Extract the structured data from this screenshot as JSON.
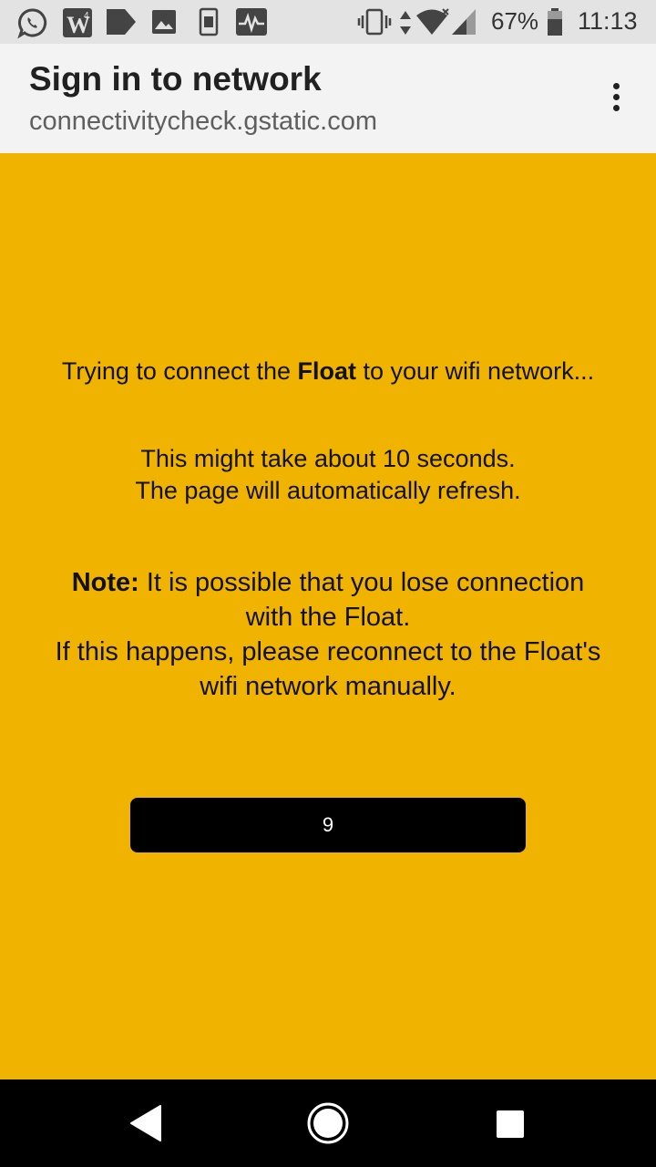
{
  "status_bar": {
    "icons": [
      "whatsapp-icon",
      "w-notification-icon",
      "play-icon",
      "image-icon",
      "sim-icon",
      "activity-icon",
      "vibrate-icon",
      "data-arrows-icon",
      "wifi-icon",
      "signal-icon",
      "battery-icon"
    ],
    "battery_percent": "67%",
    "time": "11:13"
  },
  "app_bar": {
    "title": "Sign in to network",
    "url": "connectivitycheck.gstatic.com",
    "menu_icon": "overflow-menu-icon"
  },
  "content": {
    "background": "#f0b400",
    "message1_before": "Trying to connect the ",
    "message1_bold": "Float",
    "message1_after": " to your wifi network...",
    "message2_line1": "This might take about 10 seconds.",
    "message2_line2": "The page will automatically refresh.",
    "note_label": "Note:",
    "note_line1": " It is possible that you lose connection with the Float.",
    "note_line2": "If this happens, please reconnect to the Float's wifi network manually.",
    "countdown": "9"
  },
  "nav_bar": {
    "icons": [
      "back-icon",
      "home-icon",
      "recents-icon"
    ]
  }
}
